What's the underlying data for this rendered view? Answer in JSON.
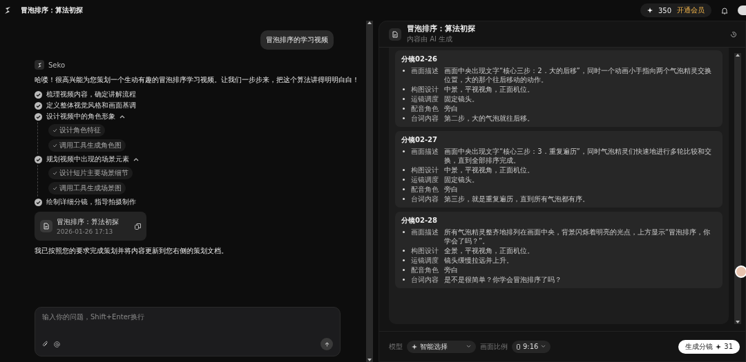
{
  "topbar": {
    "title": "冒泡排序：算法初探",
    "credits": "350",
    "upgrade": "开通会员"
  },
  "chat": {
    "user_message": "冒泡排序的学习视频",
    "bot_name": "Seko",
    "intro": "哈喽！很高兴能为您策划一个生动有趣的冒泡排序学习视频。让我们一步步来，把这个算法讲得明明白白！",
    "steps": [
      {
        "label": "梳理视频内容，确定讲解流程",
        "expanded": false
      },
      {
        "label": "定义整体视觉风格和画面基调",
        "expanded": false
      },
      {
        "label": "设计视频中的角色形象",
        "expanded": true,
        "children": [
          "设计角色特征",
          "调用工具生成角色图"
        ]
      },
      {
        "label": "规划视频中出现的场景元素",
        "expanded": true,
        "children": [
          "设计短片主要场景细节",
          "调用工具生成场景图"
        ]
      },
      {
        "label": "绘制详细分镜，指导拍摄制作",
        "expanded": false
      }
    ],
    "doc_card": {
      "title": "冒泡排序：算法初探",
      "date": "2026-01-26 17:13"
    },
    "outro": "我已按照您的要求完成策划并将内容更新到您右侧的策划文档。",
    "input": {
      "placeholder": "输入你的问题，Shift+Enter换行"
    }
  },
  "doc": {
    "title": "冒泡排序：算法初探",
    "subtitle": "内容由 AI 生成",
    "shots": [
      {
        "heading": "分镜02-26",
        "fields": [
          {
            "label": "画面描述",
            "value": "画面中央出现文字“核心三步：2．大的后移”，同时一个动画小手指向两个气泡精灵交换位置，大的那个往后移动的动作。"
          },
          {
            "label": "构图设计",
            "value": "中景，平视视角，正面机位。"
          },
          {
            "label": "运镜调度",
            "value": "固定镜头。"
          },
          {
            "label": "配音角色",
            "value": "旁白"
          },
          {
            "label": "台词内容",
            "value": "第二步，大的气泡就往后移。"
          }
        ]
      },
      {
        "heading": "分镜02-27",
        "fields": [
          {
            "label": "画面描述",
            "value": "画面中央出现文字“核心三步：3．重复遍历”，同时气泡精灵们快速地进行多轮比较和交换，直到全部排序完成。"
          },
          {
            "label": "构图设计",
            "value": "中景，平视视角，正面机位。"
          },
          {
            "label": "运镜调度",
            "value": "固定镜头。"
          },
          {
            "label": "配音角色",
            "value": "旁白"
          },
          {
            "label": "台词内容",
            "value": "第三步，就是重复遍历，直到所有气泡都有序。"
          }
        ]
      },
      {
        "heading": "分镜02-28",
        "fields": [
          {
            "label": "画面描述",
            "value": "所有气泡精灵整齐地排列在画面中央，背景闪烁着明亮的光点，上方显示“冒泡排序，你学会了吗？”。"
          },
          {
            "label": "构图设计",
            "value": "全景，平视视角，正面机位。"
          },
          {
            "label": "运镜调度",
            "value": "镜头缓慢拉远并上升。"
          },
          {
            "label": "配音角色",
            "value": "旁白"
          },
          {
            "label": "台词内容",
            "value": "是不是很简单？你学会冒泡排序了吗？"
          }
        ]
      }
    ],
    "footer": {
      "model_label": "模型",
      "model_value": "智能选择",
      "ratio_label": "画面比例",
      "ratio_value": "9:16",
      "generate": "生成分镜",
      "generate_cost": "31"
    }
  }
}
